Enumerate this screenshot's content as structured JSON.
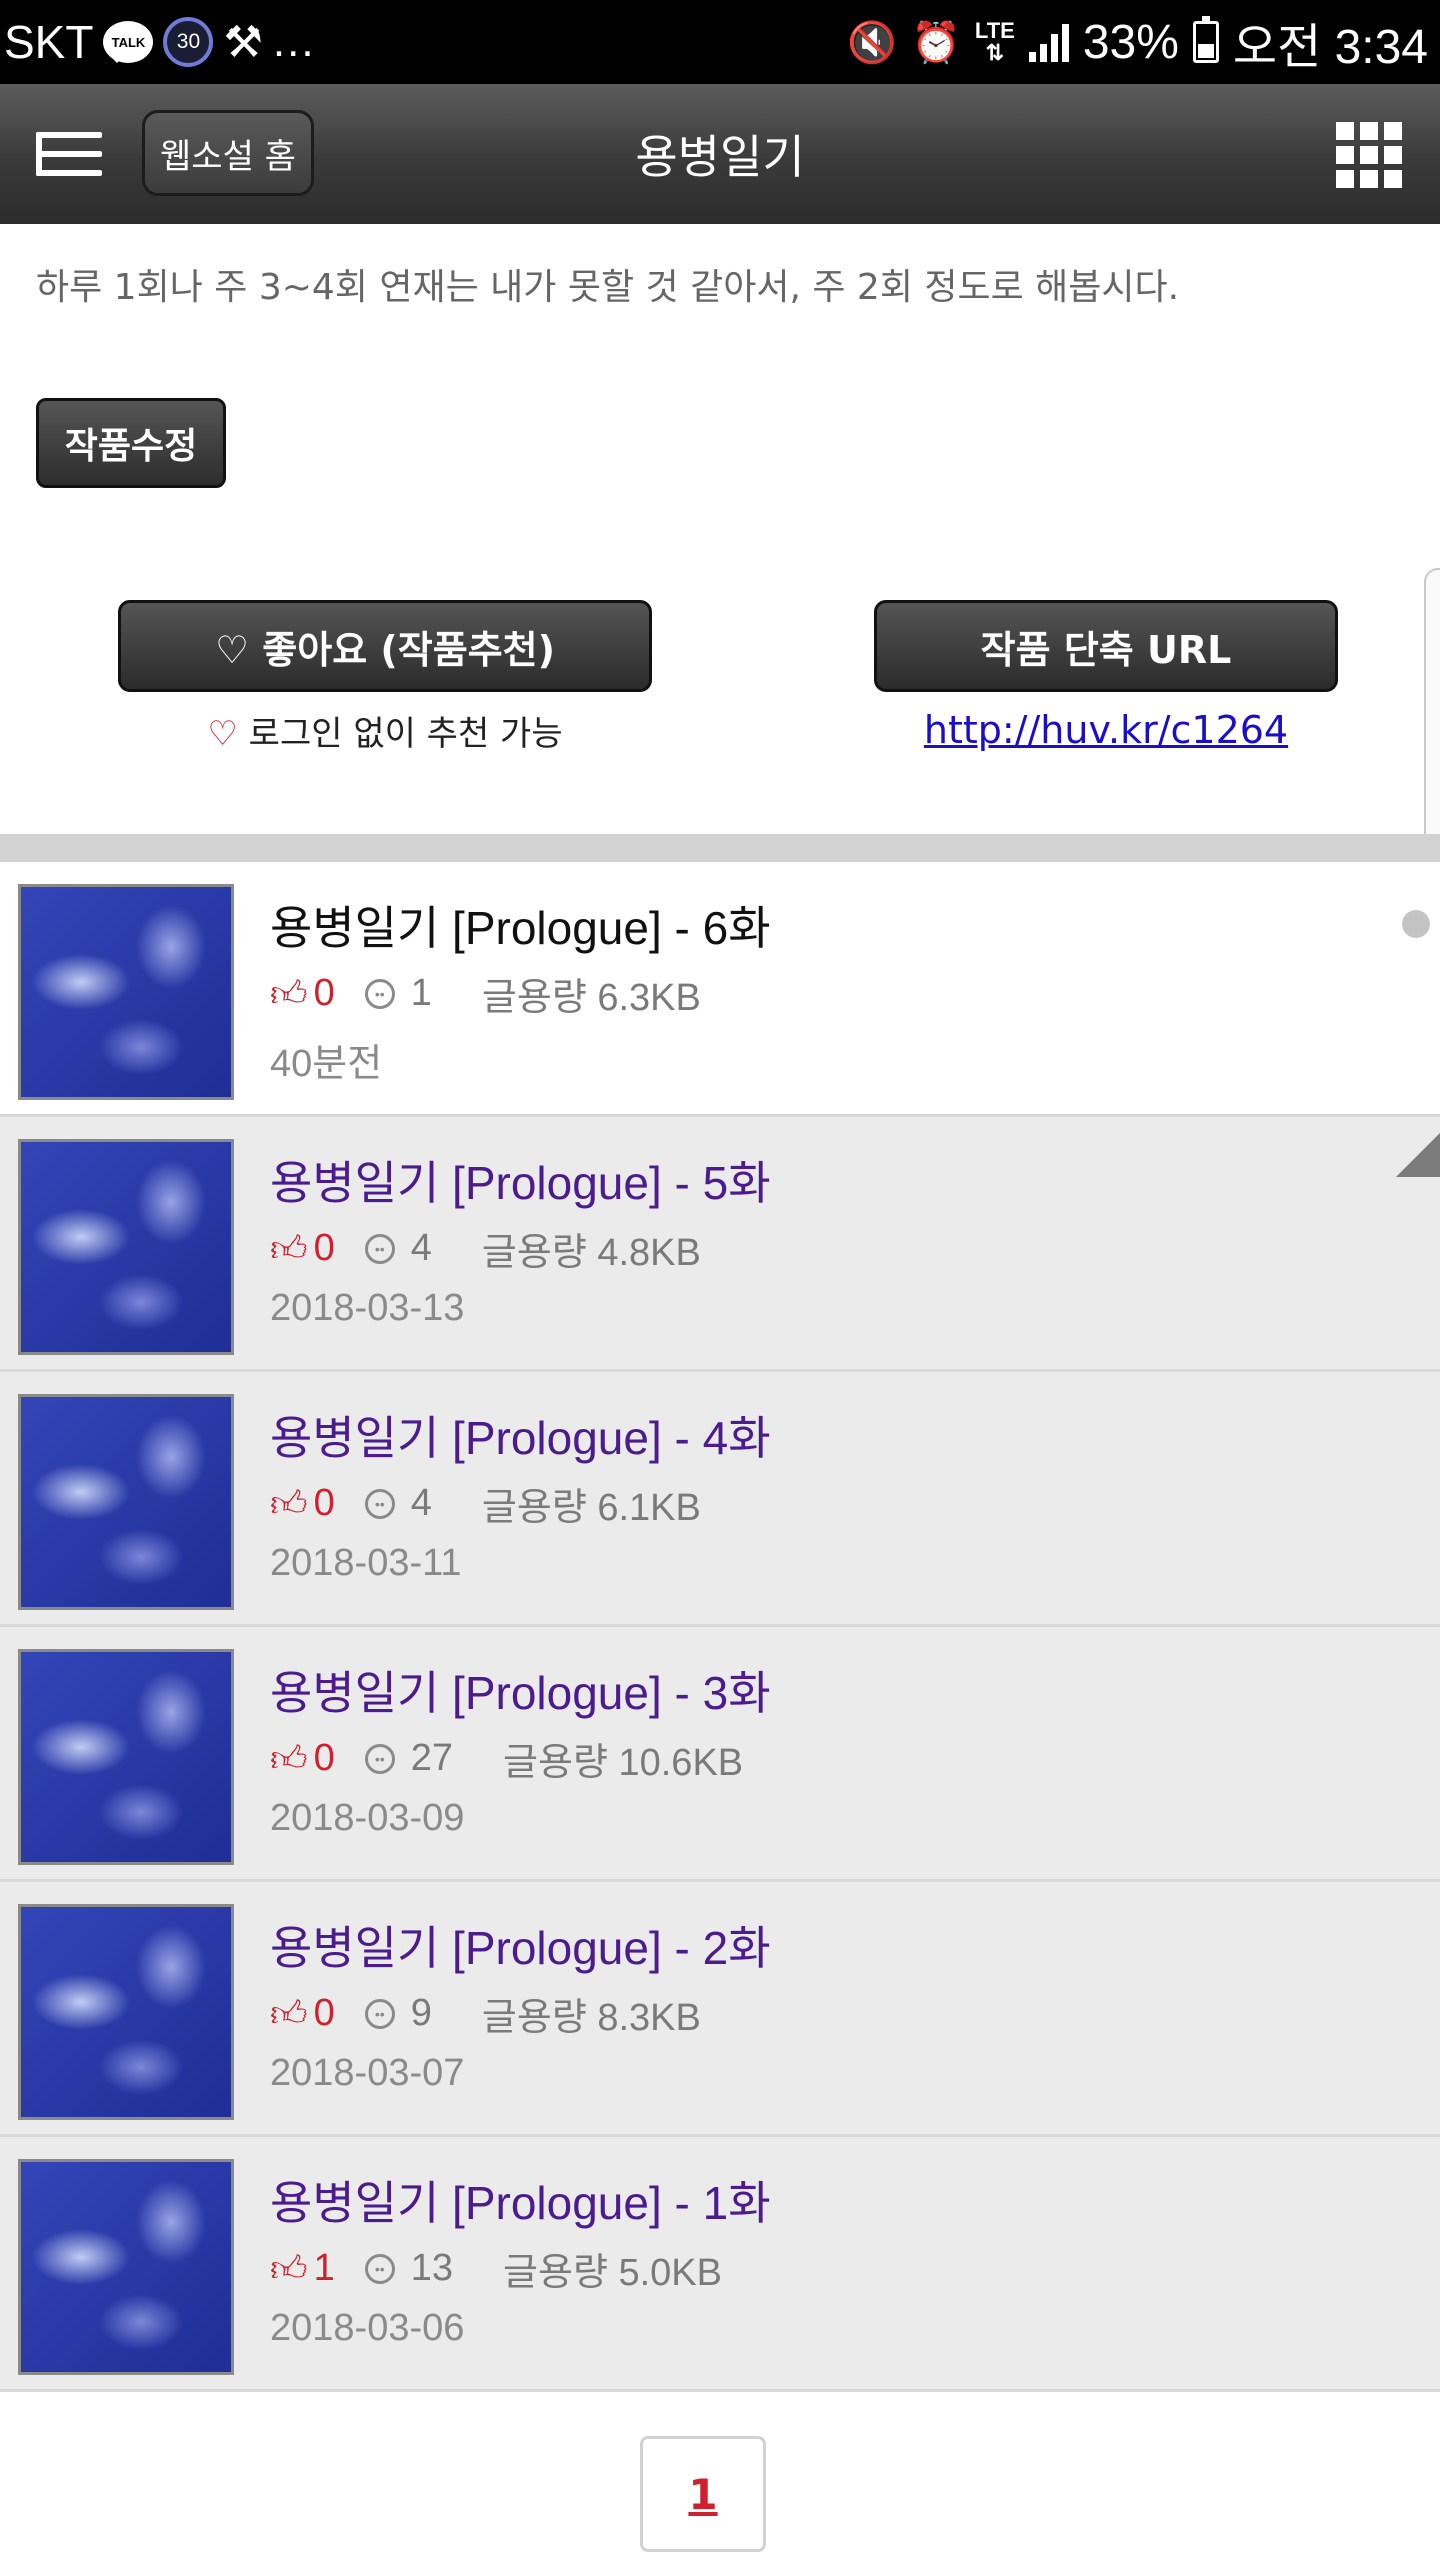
{
  "status_bar": {
    "carrier": "SKT",
    "talk_label": "TALK",
    "badge_number": "30",
    "more": "...",
    "lte_label": "LTE",
    "battery_percent": "33%",
    "time": "오전 3:34"
  },
  "header": {
    "home_button": "웹소설 홈",
    "title": "용병일기"
  },
  "work": {
    "description": "하루 1회나 주 3~4회 연재는 내가 못할 것 같아서, 주 2회 정도로 해봅시다.",
    "edit_button": "작품수정",
    "like_button": "♡ 좋아요 (작품추천)",
    "like_note": "로그인 없이 추천 가능",
    "url_button": "작품 단축 URL",
    "short_url": "http://huv.kr/c1264"
  },
  "episodes": [
    {
      "title": "용병일기 [Prologue] - 6화",
      "likes": "0",
      "comments": "1",
      "size": "글용량 6.3KB",
      "date": "40분전"
    },
    {
      "title": "용병일기 [Prologue] - 5화",
      "likes": "0",
      "comments": "4",
      "size": "글용량 4.8KB",
      "date": "2018-03-13"
    },
    {
      "title": "용병일기 [Prologue] - 4화",
      "likes": "0",
      "comments": "4",
      "size": "글용량 6.1KB",
      "date": "2018-03-11"
    },
    {
      "title": "용병일기 [Prologue] - 3화",
      "likes": "0",
      "comments": "27",
      "size": "글용량 10.6KB",
      "date": "2018-03-09"
    },
    {
      "title": "용병일기 [Prologue] - 2화",
      "likes": "0",
      "comments": "9",
      "size": "글용량 8.3KB",
      "date": "2018-03-07"
    },
    {
      "title": "용병일기 [Prologue] - 1화",
      "likes": "1",
      "comments": "13",
      "size": "글용량 5.0KB",
      "date": "2018-03-06"
    }
  ],
  "pagination": {
    "current_page": "1"
  },
  "colors": {
    "accent_red": "#d0202e",
    "visited_title": "#4b1b8f",
    "link_blue": "#1a0dcc",
    "header_dark": "#3a3a3a"
  },
  "icons": [
    "talk-icon",
    "mute-icon",
    "alarm-icon",
    "signal-icon",
    "battery-icon",
    "menu-icon",
    "grid-icon",
    "thumbs-up-icon",
    "comment-icon",
    "heart-icon"
  ]
}
